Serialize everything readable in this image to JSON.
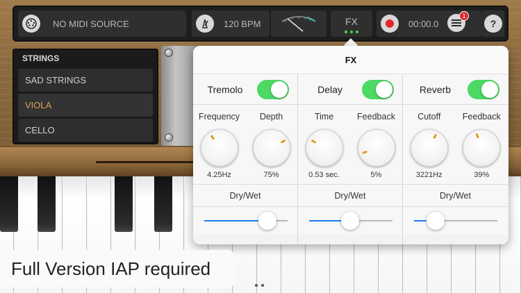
{
  "toolbar": {
    "midi_source": "NO MIDI SOURCE",
    "bpm": "120 BPM",
    "fx_label": "FX",
    "time": "00:00.0",
    "notification_count": "1",
    "help_label": "?"
  },
  "strings": {
    "title": "STRINGS",
    "items": [
      {
        "label": "SAD STRINGS",
        "selected": false
      },
      {
        "label": "VIOLA",
        "selected": true
      },
      {
        "label": "CELLO",
        "selected": false
      }
    ]
  },
  "fx_popover": {
    "title": "FX",
    "effects": [
      {
        "name": "Tremolo",
        "enabled": true,
        "params": [
          {
            "label": "Frequency",
            "value": "4.25Hz"
          },
          {
            "label": "Depth",
            "value": "75%"
          }
        ],
        "drywet_label": "Dry/Wet",
        "drywet": 0.76
      },
      {
        "name": "Delay",
        "enabled": true,
        "params": [
          {
            "label": "Time",
            "value": "0.53 sec."
          },
          {
            "label": "Feedback",
            "value": "5%"
          }
        ],
        "drywet_label": "Dry/Wet",
        "drywet": 0.49
      },
      {
        "name": "Reverb",
        "enabled": true,
        "params": [
          {
            "label": "Cutoff",
            "value": "3221Hz"
          },
          {
            "label": "Feedback",
            "value": "39%"
          }
        ],
        "drywet_label": "Dry/Wet",
        "drywet": 0.26
      }
    ]
  },
  "banner": {
    "text": "Full Version IAP required"
  },
  "colors": {
    "toggle_on": "#4cd964",
    "slider_fill": "#1a7cf0",
    "knob_mark": "#e19a1c",
    "record": "#e4262b",
    "selected_string": "#d6a35a"
  }
}
